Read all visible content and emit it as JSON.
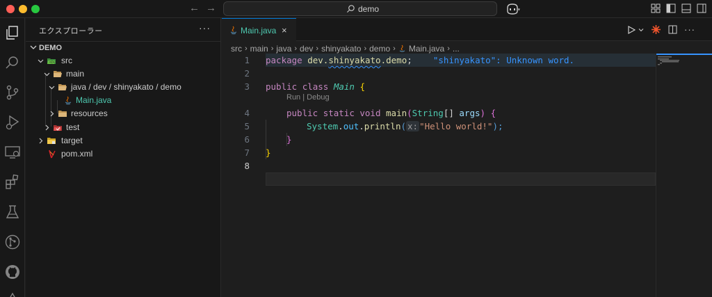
{
  "titlebar": {
    "search_text": "demo"
  },
  "sidebar": {
    "title": "エクスプローラー",
    "more": "···",
    "section": "DEMO",
    "tree": [
      {
        "label": "src",
        "level": 1,
        "expanded": true,
        "icon": "src-folder-icon"
      },
      {
        "label": "main",
        "level": 2,
        "expanded": true,
        "icon": "folder-open-icon"
      },
      {
        "label": "java / dev / shinyakato / demo",
        "level": 3,
        "expanded": true,
        "icon": "folder-open-icon"
      },
      {
        "label": "Main.java",
        "level": 4,
        "selected": true,
        "icon": "java-icon"
      },
      {
        "label": "resources",
        "level": 3,
        "expanded": false,
        "icon": "folder-icon"
      },
      {
        "label": "test",
        "level": 2,
        "expanded": false,
        "icon": "test-folder-icon"
      },
      {
        "label": "target",
        "level": 1,
        "expanded": false,
        "icon": "target-folder-icon"
      },
      {
        "label": "pom.xml",
        "level": 1,
        "icon": "maven-icon"
      }
    ]
  },
  "editor": {
    "tab": {
      "label": "Main.java",
      "close": "×"
    },
    "breadcrumbs": [
      "src",
      "main",
      "java",
      "dev",
      "shinyakato",
      "demo",
      "Main.java",
      "..."
    ],
    "codelens": "Run | Debug",
    "line_numbers": [
      "1",
      "2",
      "3",
      "4",
      "5",
      "6",
      "7",
      "8"
    ],
    "lines": {
      "l1_kw": "package",
      "l1_pkg_a": "dev.",
      "l1_pkg_b": "shinyakato",
      "l1_pkg_c": ".demo",
      "l1_semi": ";",
      "l1_diag": "\"shinyakato\": Unknown word.",
      "l3_mod": "public",
      "l3_class": "class",
      "l3_name": "Main",
      "l3_brace": "{",
      "l4_public": "public",
      "l4_static": "static",
      "l4_void": "void",
      "l4_fn": "main",
      "l4_paren_open": "(",
      "l4_type": "String",
      "l4_arr": "[]",
      "l4_param": "args",
      "l4_paren_close": ")",
      "l4_brace": "{",
      "l5_class": "System",
      "l5_dot1": ".",
      "l5_field": "out",
      "l5_dot2": ".",
      "l5_fn": "println",
      "l5_paren_open": "(",
      "l5_inlay": "x:",
      "l5_str": "\"Hello world!\"",
      "l5_paren_close": ");",
      "l6_brace": "}",
      "l7_brace": "}"
    }
  },
  "colors": {
    "accent": "#0078d4",
    "selected_file": "#4ec9b0",
    "diagnostic": "#3794ff"
  }
}
